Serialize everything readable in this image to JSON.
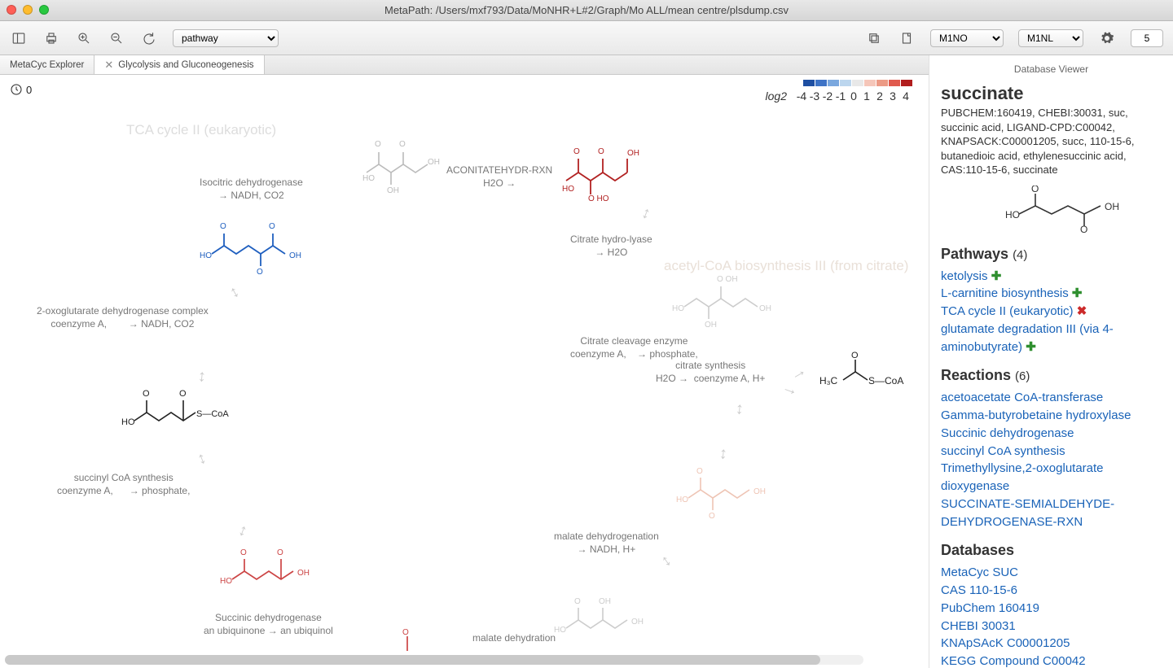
{
  "window": {
    "title": "MetaPath: /Users/mxf793/Data/MoNHR+L#2/Graph/Mo ALL/mean centre/plsdump.csv"
  },
  "toolbar": {
    "mode_select": "pathway",
    "left_select": "M1NO",
    "right_select": "M1NL",
    "spinner": "5"
  },
  "tabs": [
    {
      "label": "MetaCyc Explorer",
      "closable": false,
      "active": false
    },
    {
      "label": "Glycolysis and Gluconeogenesis",
      "closable": true,
      "active": true
    }
  ],
  "time_counter": "0",
  "legend": {
    "prefix": "log2",
    "ticks": [
      "-4",
      "-3",
      "-2",
      "-1",
      "0",
      "1",
      "2",
      "3",
      "4"
    ],
    "colors": [
      "#1E4FA2",
      "#3E73C6",
      "#7AA7DE",
      "#BCD6EE",
      "#E8E8E8",
      "#F5C6B9",
      "#EC9A85",
      "#E05A4E",
      "#B11D1D"
    ]
  },
  "pathway_titles": {
    "tca": "TCA cycle II (eukaryotic)",
    "acetyl": "acetyl-CoA biosynthesis III (from citrate)"
  },
  "reactions": {
    "isocitrate_dh": {
      "name": "Isocitric dehydrogenase",
      "prod": "→ NADH, CO2"
    },
    "aconitate": {
      "name": "ACONITATEHYDR-RXN",
      "prod": "H2O →"
    },
    "citrate_hydro": {
      "name": "Citrate hydro-lyase",
      "prod": "→ H2O"
    },
    "akg_dh": {
      "name": "2-oxoglutarate dehydrogenase complex",
      "sub": "coenzyme A,",
      "prod": "→ NADH, CO2"
    },
    "citrate_cleave": {
      "name": "Citrate cleavage enzyme",
      "sub": "coenzyme A,",
      "prod": "→ phosphate,"
    },
    "citrate_synth": {
      "name": "citrate synthesis",
      "sub": "H2O →",
      "prod": "coenzyme A, H+"
    },
    "succ_coa_synth": {
      "name": "succinyl CoA synthesis",
      "sub": "coenzyme A,",
      "prod": "→ phosphate,"
    },
    "succ_dh": {
      "name": "Succinic dehydrogenase",
      "sub": "an ubiquinone → an ubiquinol"
    },
    "mal_dhation": {
      "name": "malate dehydrogenation",
      "prod": "→ NADH, H+"
    },
    "mal_dhration": {
      "name": "malate dehydration"
    }
  },
  "sidebar": {
    "panel_title": "Database Viewer",
    "name": "succinate",
    "aliases": "PUBCHEM:160419, CHEBI:30031, suc, succinic acid, LIGAND-CPD:C00042, KNAPSACK:C00001205, succ, 110-15-6, butanedioic acid, ethylenesuccinic acid, CAS:110-15-6, succinate",
    "pathways_head": "Pathways",
    "pathways_count": "(4)",
    "pathways": [
      {
        "label": "ketolysis",
        "badge": "add"
      },
      {
        "label": "L-carnitine biosynthesis",
        "badge": "add"
      },
      {
        "label": "TCA cycle II (eukaryotic)",
        "badge": "rem"
      },
      {
        "label": "glutamate degradation III (via 4-aminobutyrate)",
        "badge": "add"
      }
    ],
    "reactions_head": "Reactions",
    "reactions_count": "(6)",
    "reactions": [
      "acetoacetate CoA-transferase",
      "Gamma-butyrobetaine hydroxylase",
      "Succinic dehydrogenase",
      "succinyl CoA synthesis",
      "Trimethyllysine,2-oxoglutarate dioxygenase",
      "SUCCINATE-SEMIALDEHYDE-DEHYDROGENASE-RXN"
    ],
    "databases_head": "Databases",
    "databases": [
      "MetaCyc SUC",
      "CAS 110-15-6",
      "PubChem 160419",
      "CHEBI 30031",
      "KNApSAcK C00001205",
      "KEGG Compound C00042"
    ]
  }
}
